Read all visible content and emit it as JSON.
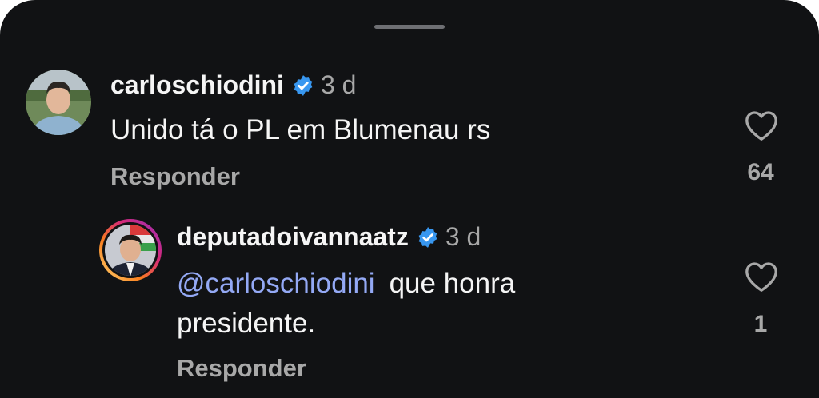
{
  "comments": [
    {
      "username": "carloschiodini",
      "time": "3 d",
      "text": "Unido tá o PL em Blumenau rs",
      "reply_label": "Responder",
      "likes": "64"
    },
    {
      "username": "deputadoivannaatz",
      "time": "3 d",
      "mention": "@carloschiodini",
      "text": "que honra presidente.",
      "reply_label": "Responder",
      "likes": "1"
    }
  ],
  "colors": {
    "background": "#111214",
    "verified": "#3897f0",
    "mention": "#94a9f5"
  }
}
